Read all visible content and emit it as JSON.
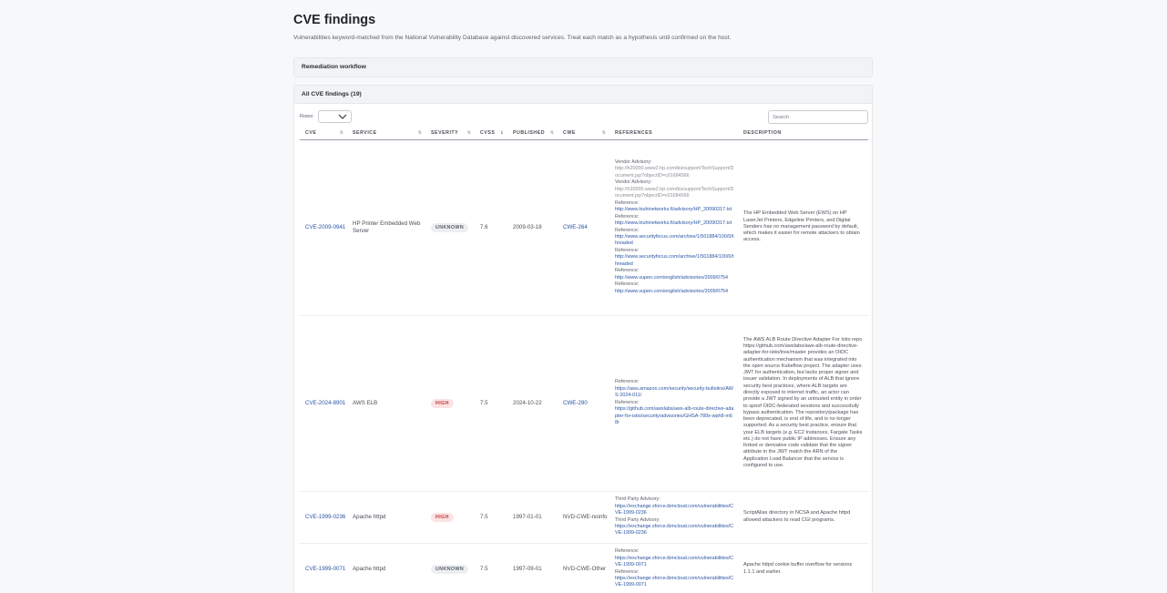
{
  "page": {
    "title": "CVE findings",
    "subtitle": "Vulnerabilities keyword-matched from the National Vulnerability Database against discovered services. Treat each match as a hypothesis until confirmed on the host."
  },
  "workflow": {
    "label": "Remediation workflow"
  },
  "findings": {
    "label": "All CVE findings (19)",
    "rows_label": "Rows:",
    "rows_value": "",
    "search_placeholder": "Search",
    "columns": [
      "CVE",
      "SERVICE",
      "SEVERITY",
      "CVSS",
      "PUBLISHED",
      "CWE",
      "REFERENCES",
      "DESCRIPTION"
    ],
    "sorted_column": "CVSS",
    "rows": [
      {
        "cve": "CVE-2009-0941",
        "service": "HP Printer Embedded Web Server",
        "severity": "UNKNOWN",
        "cvss": "7.6",
        "published": "2009-03-18",
        "cwe": "CWE-264",
        "refs": [
          {
            "label": "Vendor Advisory:",
            "url": "http://h20000.www2.hp.com/bizsupport/TechSupport/Document.jsp?objectID=c01684566",
            "muted": true
          },
          {
            "label": "Vendor Advisory:",
            "url": "http://h20000.www2.hp.com/bizsupport/TechSupport/Document.jsp?objectID=c01684566",
            "muted": true
          },
          {
            "label": "Reference:",
            "url": "http://www.louhinetworks.fi/advisory/HP_20090317.txt"
          },
          {
            "label": "Reference:",
            "url": "http://www.louhinetworks.fi/advisory/HP_20090317.txt"
          },
          {
            "label": "Reference:",
            "url": "http://www.securityfocus.com/archive/1/501884/100/0/threaded"
          },
          {
            "label": "Reference:",
            "url": "http://www.securityfocus.com/archive/1/501884/100/0/threaded"
          },
          {
            "label": "Reference:",
            "url": "http://www.vupen.com/english/advisories/2009/0754"
          },
          {
            "label": "Reference:",
            "url": "http://www.vupen.com/english/advisories/2009/0754"
          }
        ],
        "description": "The HP Embedded Web Server (EWS) on HP LaserJet Printers, Edgeline Printers, and Digital Senders has no management password by default, which makes it easier for remote attackers to obtain access."
      },
      {
        "cve": "CVE-2024-8901",
        "service": "AWS ELB",
        "severity": "HIGH",
        "cvss": "7.5",
        "published": "2024-10-22",
        "cwe": "CWE-290",
        "refs": [
          {
            "label": "Reference:",
            "url": "https://aws.amazon.com/security/security-bulletins/AWS-2024-011/"
          },
          {
            "label": "Reference:",
            "url": "https://github.com/awslabs/aws-alb-route-directive-adapter-for-istio/security/advisories/GHSA-789x-wph8-m68r"
          }
        ],
        "description": "The AWS ALB Route Directive Adapter For Istio repo https://github.com/awslabs/aws-alb-route-directive-adapter-for-istio/tree/master provides an OIDC authentication mechanism that was integrated into the open source Kubeflow project. The adapter uses JWT for authentication, but lacks proper signer and issuer validation. In deployments of ALB that ignore security best practices, where ALB targets are directly exposed to internet traffic, an actor can provide a JWT signed by an untrusted entity in order to spoof OIDC-federated sessions and successfully bypass authentication. The repository/package has been deprecated, is end of life, and is no longer supported. As a security best practice, ensure that your ELB targets (e.g. EC2 Instances, Fargate Tasks etc.) do not have public IP addresses. Ensure any forked or derivative code validate that the signer attribute in the JWT match the ARN of the Application Load Balancer that the service is configured to use."
      },
      {
        "cve": "CVE-1999-0236",
        "service": "Apache httpd",
        "severity": "HIGH",
        "cvss": "7.5",
        "published": "1997-01-01",
        "cwe": "NVD-CWE-noinfo",
        "refs": [
          {
            "label": "Third Party Advisory:",
            "url": "https://exchange.xforce.ibmcloud.com/vulnerabilities/CVE-1999-0236"
          },
          {
            "label": "Third Party Advisory:",
            "url": "https://exchange.xforce.ibmcloud.com/vulnerabilities/CVE-1999-0236"
          }
        ],
        "description": "ScriptAlias directory in NCSA and Apache httpd allowed attackers to read CGI programs."
      },
      {
        "cve": "CVE-1999-0071",
        "service": "Apache httpd",
        "severity": "UNKNOWN",
        "cvss": "7.5",
        "published": "1997-09-01",
        "cwe": "NVD-CWE-Other",
        "refs": [
          {
            "label": "Reference:",
            "url": "https://exchange.xforce.ibmcloud.com/vulnerabilities/CVE-1999-0071"
          },
          {
            "label": "Reference:",
            "url": "https://exchange.xforce.ibmcloud.com/vulnerabilities/CVE-1999-0071"
          }
        ],
        "description": "Apache httpd cookie buffer overflow for versions 1.1.1 and earlier."
      }
    ]
  },
  "colors": {
    "link": "#2955a3",
    "high_bg": "#fbe3e3",
    "high_text": "#c0393b",
    "unknown_bg": "#eceef1",
    "unknown_text": "#5b616b"
  }
}
